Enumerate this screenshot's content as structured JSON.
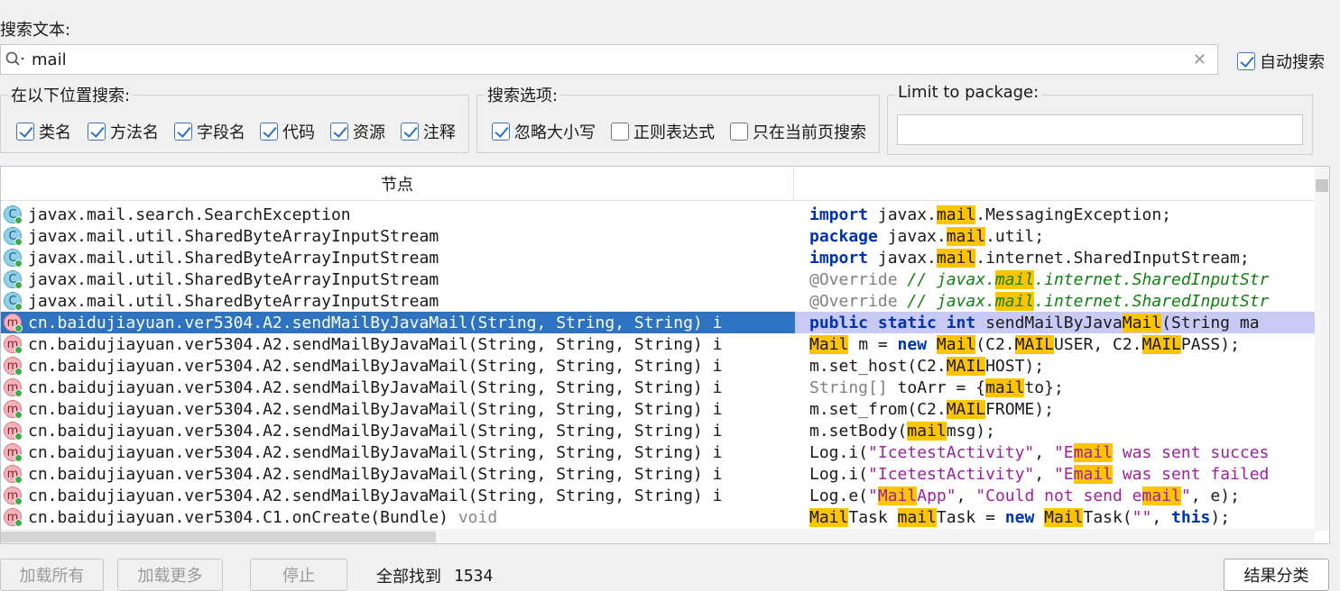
{
  "search": {
    "label": "搜索文本:",
    "value": "mail",
    "auto_label": "自动搜索"
  },
  "scope": {
    "legend": "在以下位置搜索:",
    "items": [
      {
        "label": "类名",
        "checked": true
      },
      {
        "label": "方法名",
        "checked": true
      },
      {
        "label": "字段名",
        "checked": true
      },
      {
        "label": "代码",
        "checked": true
      },
      {
        "label": "资源",
        "checked": true
      },
      {
        "label": "注释",
        "checked": true
      }
    ]
  },
  "options": {
    "legend": "搜索选项:",
    "items": [
      {
        "label": "忽略大小写",
        "checked": true
      },
      {
        "label": "正则表达式",
        "checked": false
      },
      {
        "label": "只在当前页搜索",
        "checked": false
      }
    ]
  },
  "package": {
    "legend": "Limit to package:",
    "value": ""
  },
  "results": {
    "column_header": "节点",
    "rows": [
      {
        "icon": "C",
        "node": "javax.mail.search.SearchException",
        "code": [
          [
            "import",
            "kw"
          ],
          [
            " javax.",
            ""
          ],
          [
            "mail",
            "hl"
          ],
          [
            ".MessagingException;",
            ""
          ]
        ]
      },
      {
        "icon": "C",
        "node": "javax.mail.util.SharedByteArrayInputStream",
        "code": [
          [
            "package",
            "kw"
          ],
          [
            " javax.",
            ""
          ],
          [
            "mail",
            "hl"
          ],
          [
            ".util;",
            ""
          ]
        ]
      },
      {
        "icon": "C",
        "node": "javax.mail.util.SharedByteArrayInputStream",
        "code": [
          [
            "import",
            "kw"
          ],
          [
            " javax.",
            ""
          ],
          [
            "mail",
            "hl"
          ],
          [
            ".internet.SharedInputStream;",
            ""
          ]
        ]
      },
      {
        "icon": "C",
        "node": "javax.mail.util.SharedByteArrayInputStream",
        "code": [
          [
            "@Override",
            "ann"
          ],
          [
            " // javax.",
            "cmt"
          ],
          [
            "mail",
            "hl cmt"
          ],
          [
            ".internet.SharedInputStr",
            "cmt"
          ]
        ]
      },
      {
        "icon": "C",
        "node": "javax.mail.util.SharedByteArrayInputStream",
        "code": [
          [
            "@Override",
            "ann"
          ],
          [
            " // javax.",
            "cmt"
          ],
          [
            "mail",
            "hl cmt"
          ],
          [
            ".internet.SharedInputStr",
            "cmt"
          ]
        ]
      },
      {
        "icon": "m",
        "node": "cn.baidujiayuan.ver5304.A2.sendMailByJavaMail(String, String, String) i",
        "selected": true,
        "code": [
          [
            "public static int",
            "kw"
          ],
          [
            " sendMailByJava",
            ""
          ],
          [
            "Mail",
            "hl"
          ],
          [
            "(String ma",
            ""
          ]
        ]
      },
      {
        "icon": "m",
        "node": "cn.baidujiayuan.ver5304.A2.sendMailByJavaMail(String, String, String) i",
        "code": [
          [
            "Mail",
            "hl"
          ],
          [
            " m = ",
            ""
          ],
          [
            "new",
            "kw"
          ],
          [
            " ",
            ""
          ],
          [
            "Mail",
            "hl"
          ],
          [
            "(C2.",
            ""
          ],
          [
            "MAIL",
            "hl"
          ],
          [
            "USER, C2.",
            ""
          ],
          [
            "MAIL",
            "hl"
          ],
          [
            "PASS);",
            ""
          ]
        ]
      },
      {
        "icon": "m",
        "node": "cn.baidujiayuan.ver5304.A2.sendMailByJavaMail(String, String, String) i",
        "code": [
          [
            "m.set_host(C2.",
            ""
          ],
          [
            "MAIL",
            "hl"
          ],
          [
            "HOST);",
            ""
          ]
        ]
      },
      {
        "icon": "m",
        "node": "cn.baidujiayuan.ver5304.A2.sendMailByJavaMail(String, String, String) i",
        "code": [
          [
            "String[]",
            "ann"
          ],
          [
            " toArr = {",
            ""
          ],
          [
            "mail",
            "hl"
          ],
          [
            "to};",
            ""
          ]
        ]
      },
      {
        "icon": "m",
        "node": "cn.baidujiayuan.ver5304.A2.sendMailByJavaMail(String, String, String) i",
        "code": [
          [
            "m.set_from(C2.",
            ""
          ],
          [
            "MAIL",
            "hl"
          ],
          [
            "FROME);",
            ""
          ]
        ]
      },
      {
        "icon": "m",
        "node": "cn.baidujiayuan.ver5304.A2.sendMailByJavaMail(String, String, String) i",
        "code": [
          [
            "m.setBody(",
            ""
          ],
          [
            "mail",
            "hl"
          ],
          [
            "msg);",
            ""
          ]
        ]
      },
      {
        "icon": "m",
        "node": "cn.baidujiayuan.ver5304.A2.sendMailByJavaMail(String, String, String) i",
        "code": [
          [
            "Log.i(",
            ""
          ],
          [
            "\"IcetestActivity\"",
            "str"
          ],
          [
            ", ",
            ""
          ],
          [
            "\"E",
            "str"
          ],
          [
            "mail",
            "hl str"
          ],
          [
            " was sent succes",
            "str"
          ]
        ]
      },
      {
        "icon": "m",
        "node": "cn.baidujiayuan.ver5304.A2.sendMailByJavaMail(String, String, String) i",
        "code": [
          [
            "Log.i(",
            ""
          ],
          [
            "\"IcetestActivity\"",
            "str"
          ],
          [
            ", ",
            ""
          ],
          [
            "\"E",
            "str"
          ],
          [
            "mail",
            "hl str"
          ],
          [
            " was sent failed",
            "str"
          ]
        ]
      },
      {
        "icon": "m",
        "node": "cn.baidujiayuan.ver5304.A2.sendMailByJavaMail(String, String, String) i",
        "code": [
          [
            "Log.e(",
            ""
          ],
          [
            "\"",
            "str"
          ],
          [
            "Mail",
            "hl str"
          ],
          [
            "App\"",
            "str"
          ],
          [
            ", ",
            ""
          ],
          [
            "\"Could not send e",
            "str"
          ],
          [
            "mail",
            "hl str"
          ],
          [
            "\"",
            "str"
          ],
          [
            ", e);",
            ""
          ]
        ]
      },
      {
        "icon": "m",
        "node": "cn.baidujiayuan.ver5304.C1.onCreate(Bundle)",
        "node_suffix": " void",
        "code": [
          [
            "Mail",
            "hl"
          ],
          [
            "Task ",
            ""
          ],
          [
            "mail",
            "hl"
          ],
          [
            "Task = ",
            ""
          ],
          [
            "new",
            "kw"
          ],
          [
            " ",
            ""
          ],
          [
            "Mail",
            "hl"
          ],
          [
            "Task(",
            ""
          ],
          [
            "\"\"",
            "str"
          ],
          [
            ", ",
            ""
          ],
          [
            "this",
            "kw"
          ],
          [
            ");",
            ""
          ]
        ]
      }
    ]
  },
  "footer": {
    "load_all": "加载所有",
    "load_more": "加载更多",
    "stop": "停止",
    "found_label": "全部找到",
    "found_count": "1534",
    "sort_button": "结果分类"
  }
}
